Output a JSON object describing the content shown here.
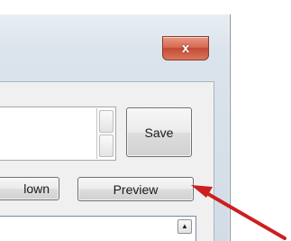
{
  "window": {
    "close_glyph": "x"
  },
  "buttons": {
    "save_label": "Save",
    "down_label": "lown",
    "preview_label": "Preview"
  },
  "list": {
    "scroll_up_glyph": "▲"
  },
  "annotation": {
    "arrow_color": "#cc1f1f",
    "arrow_target": "preview-button"
  }
}
